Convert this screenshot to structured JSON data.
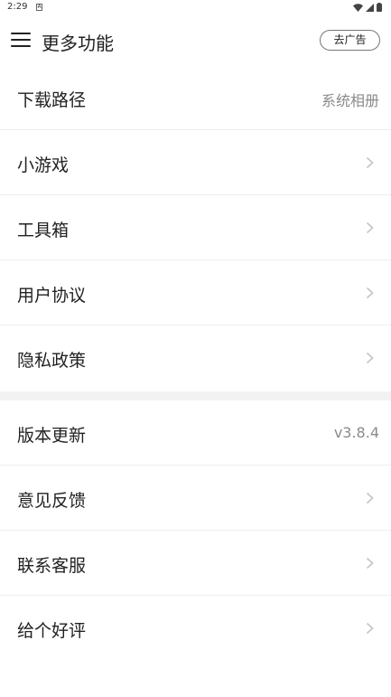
{
  "status_bar": {
    "time": "2:29",
    "notification": "A"
  },
  "header": {
    "title": "更多功能",
    "ad_button": "去广告"
  },
  "section1": [
    {
      "label": "下载路径",
      "value": "系统相册",
      "chevron": false
    },
    {
      "label": "小游戏",
      "value": null,
      "chevron": true
    },
    {
      "label": "工具箱",
      "value": null,
      "chevron": true
    },
    {
      "label": "用户协议",
      "value": null,
      "chevron": true
    },
    {
      "label": "隐私政策",
      "value": null,
      "chevron": true
    }
  ],
  "section2": [
    {
      "label": "版本更新",
      "value": "v3.8.4",
      "chevron": false
    },
    {
      "label": "意见反馈",
      "value": null,
      "chevron": true
    },
    {
      "label": "联系客服",
      "value": null,
      "chevron": true
    },
    {
      "label": "给个好评",
      "value": null,
      "chevron": true
    }
  ],
  "colors": {
    "divider": "#eeeeee",
    "section_gap": "#f2f2f2",
    "secondary_text": "#8a8a8a"
  }
}
